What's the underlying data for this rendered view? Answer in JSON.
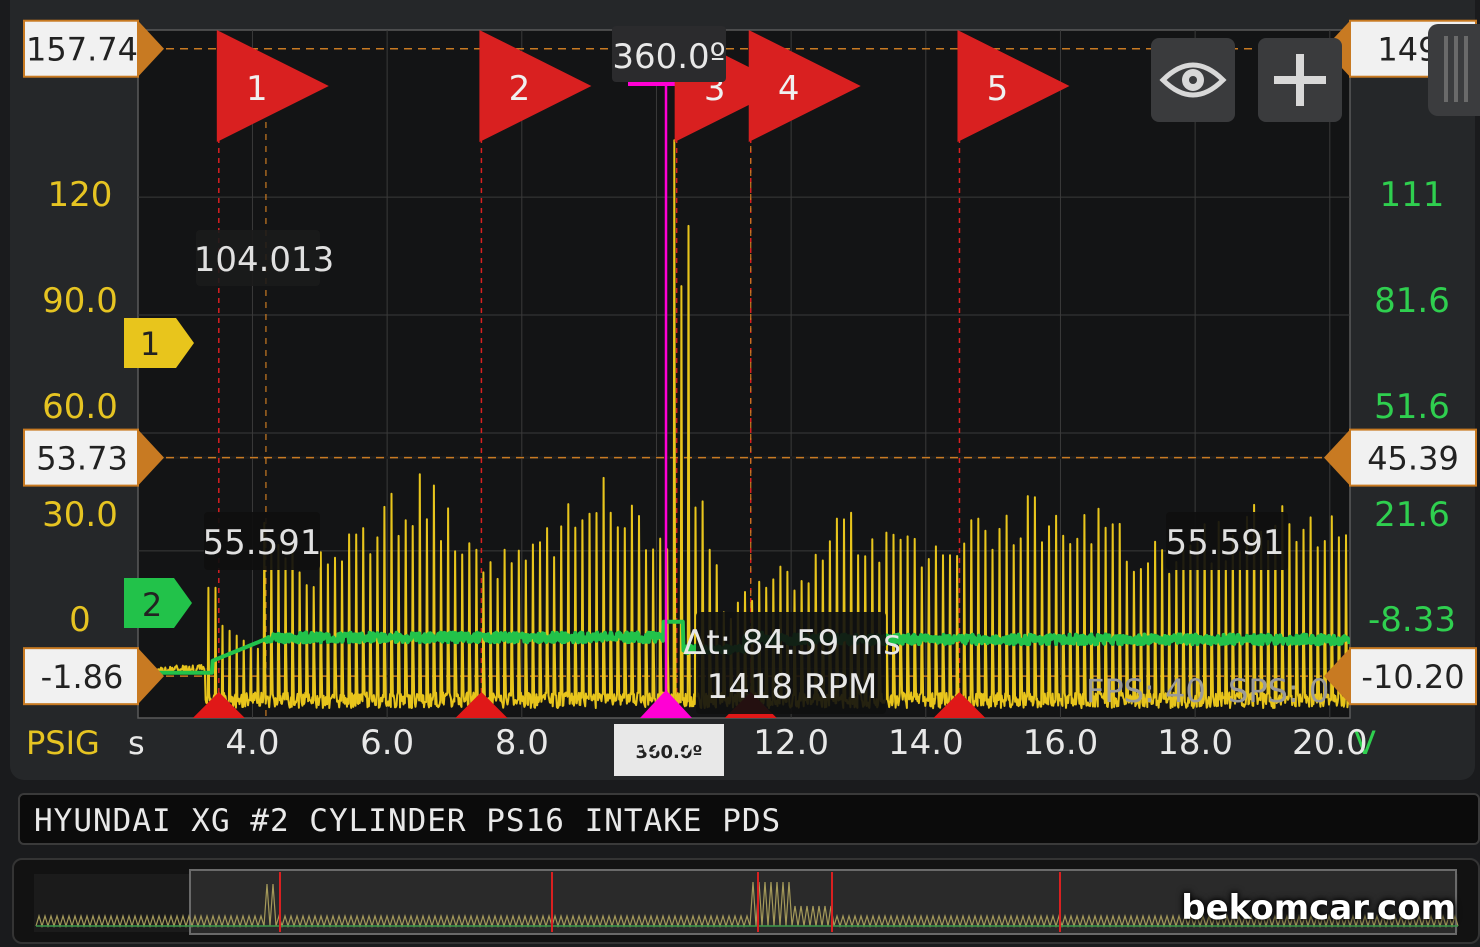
{
  "app": {
    "session_title": "HYUNDAI XG #2 CYLINDER PS16 INTAKE PDS",
    "watermark": "bekomcar.com",
    "fps_label": "FPS: 40",
    "sps_label": "SPS: 0"
  },
  "toolbar": {
    "eye_icon": "eye-icon",
    "add_icon": "plus-icon"
  },
  "axes": {
    "left_unit": "PSIG",
    "x_unit": "s",
    "right_unit": "V",
    "left_ticks": [
      "120",
      "90.0",
      "60.0",
      "30.0",
      "0"
    ],
    "left_tick_values": [
      120,
      90,
      60,
      30,
      0
    ],
    "right_ticks": [
      "111",
      "81.6",
      "51.6",
      "21.6",
      "-8.33"
    ],
    "x_ticks": [
      "4.0",
      "6.0",
      "8.0",
      "10.0",
      "12.0",
      "14.0",
      "16.0",
      "18.0",
      "20.0"
    ],
    "x_tick_values": [
      4,
      6,
      8,
      10,
      12,
      14,
      16,
      18,
      20
    ],
    "x_range": [
      2.3,
      20.3
    ],
    "y_range": [
      -12.5,
      162.5
    ]
  },
  "cursors": {
    "left_top": "157.74",
    "left_top_value": 157.74,
    "left_mid": "53.73",
    "left_mid_value": 53.73,
    "left_bottom": "-1.86",
    "left_bottom_value": -1.86,
    "right_top": "149.",
    "right_mid": "45.39",
    "right_bottom": "-10.20",
    "angle_label": "360.0º",
    "angle_small_label": "360.0º",
    "delta_t": "Δt: 84.59 ms",
    "rpm": "1418 RPM"
  },
  "readouts": {
    "peak_value": "104.013",
    "low_value_left": "55.591",
    "low_value_right": "55.591"
  },
  "channels": [
    {
      "label": "1",
      "color": "#e8c51c"
    },
    {
      "label": "2",
      "color": "#22c24a"
    }
  ],
  "markers": {
    "flag_labels": [
      "1",
      "2",
      "3",
      "4",
      "5"
    ],
    "flag_times": [
      3.5,
      7.4,
      10.3,
      11.4,
      14.5
    ]
  },
  "colors": {
    "trace1": "#e8c51c",
    "trace2": "#22c24a",
    "left_axis_text": "#e6c422",
    "right_axis_text": "#2fcf4f",
    "cursor_magenta": "#ff00d4",
    "flag_red": "#d92020",
    "cursor_orange": "#c87a22"
  }
}
